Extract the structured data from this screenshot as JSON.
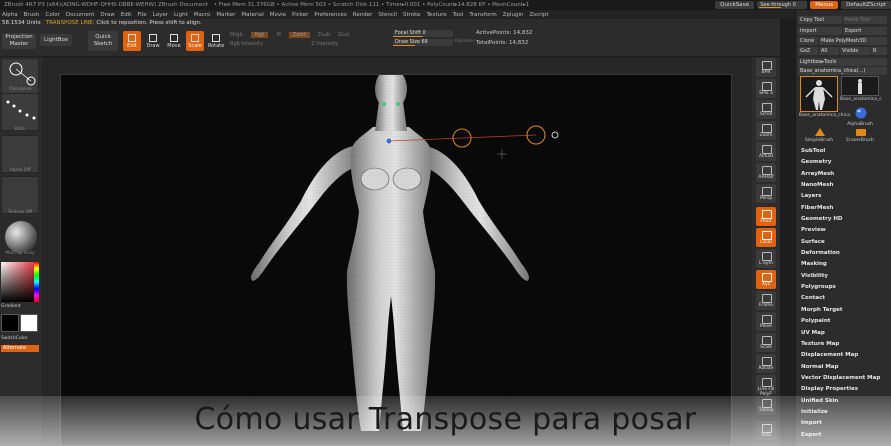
{
  "app": {
    "title": "ZBrush 4R7 P3 (x64)(ADNG-WDHF-QHHS-DBBE-WEHW)   ZBrush Document",
    "mem_info": "• Free Mem 31.376GB • Active Mem 503 • Scratch Disk 111 • Timer▸0.001 • PolyCount▸14.828 KP • MeshCount▸1",
    "quicksave": "QuickSave",
    "see_through": "See-through 0",
    "menus_btn": "Menus",
    "default_script": "DefaultZScript"
  },
  "menubar": [
    "Alpha",
    "Brush",
    "Color",
    "Document",
    "Draw",
    "Edit",
    "File",
    "Layer",
    "Light",
    "Macro",
    "Marker",
    "Material",
    "Movie",
    "Picker",
    "Preferences",
    "Render",
    "Stencil",
    "Stroke",
    "Texture",
    "Tool",
    "Transform",
    "Zplugin",
    "Zscript"
  ],
  "toolbar": {
    "units": "58.1534 Units",
    "transpose_line": "TRANSPOSE LINE:",
    "transpose_hint": "Click to reposition. Press shift to align.",
    "projection_master": "Projection Master",
    "lightbox": "LightBox",
    "quick_sketch": "Quick Sketch",
    "edit": "Edit",
    "draw": "Draw",
    "move": "Move",
    "scale": "Scale",
    "rotate": "Rotate",
    "sub_row1": [
      "Mrgb",
      "Rgb",
      "M",
      "Zadd",
      "Zsub",
      "Zcut"
    ],
    "sub_row2": [
      "Rgb Intensity",
      "Z Intensity"
    ],
    "focal_shift": "Focal Shift 0",
    "draw_size": "Draw Size 68",
    "dynamic": "Dynamic",
    "active_points": "ActivePoints: 14,832",
    "total_points": "TotalPoints: 14,832"
  },
  "left_shelf": {
    "thumb_labels": [
      "Transpose",
      "Dots",
      "Alpha Off",
      "Texture Off",
      "MatCap Gray"
    ],
    "gradient": "Gradient",
    "switch_color": "SwitchColor",
    "alternate": "Alternate"
  },
  "right_shelf": [
    "BPR",
    "SPix 3",
    "Scroll",
    "Zoom",
    "Actual",
    "AAHalf",
    "Persp",
    "Floor",
    "Local",
    "L.Sym",
    "Xyz",
    "Frame",
    "Move",
    "Scale",
    "Rotate",
    "Line Fill PolyF",
    "Transp",
    "Solo"
  ],
  "tool_palette": {
    "row1": [
      "Copy Tool",
      "Paste Tool"
    ],
    "row2": [
      "Import",
      "Export"
    ],
    "row3": [
      "Clone",
      "Make PolyMesh3D"
    ],
    "row4": [
      "GoZ",
      "All",
      "Visible",
      "R"
    ],
    "lightbox_tools": "Lightbox▸Tools",
    "current_tool": "Base_anatomica_chica(...)",
    "tools": [
      "Base_anatomica_chica",
      "Base_anatomica_c",
      "AlphaBrush",
      "SimpleBrush",
      "EraserBrush"
    ],
    "sections": [
      "SubTool",
      "Geometry",
      "ArrayMesh",
      "NanoMesh",
      "Layers",
      "FiberMesh",
      "Geometry HD",
      "Preview",
      "Surface",
      "Deformation",
      "Masking",
      "Visibility",
      "Polygroups",
      "Contact",
      "Morph Target",
      "Polypaint",
      "UV Map",
      "Texture Map",
      "Displacement Map",
      "Normal Map",
      "Vector Displacement Map",
      "Display Properties",
      "Unified Skin",
      "Initialize",
      "Import",
      "Export"
    ]
  },
  "colors": {
    "accent": "#e0630f",
    "transpose_ring": "#e08a1a",
    "canvas": "#090909"
  },
  "caption": "Cómo usar Transpose para posar"
}
